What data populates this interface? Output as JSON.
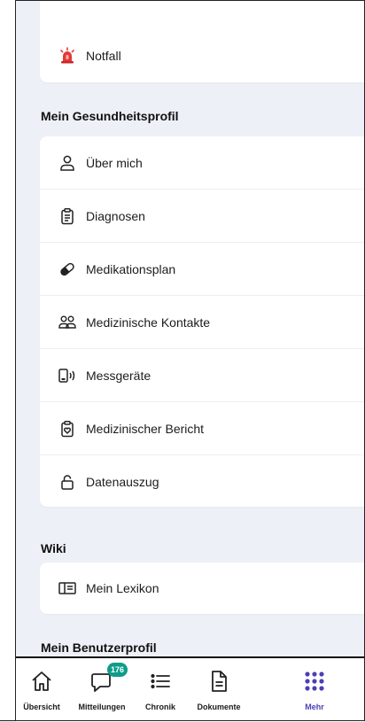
{
  "top_card": {
    "label": "Notfall"
  },
  "health_section": {
    "title": "Mein Gesundheitsprofil",
    "items": [
      {
        "label": "Über mich",
        "icon": "person-icon"
      },
      {
        "label": "Diagnosen",
        "icon": "clipboard-icon"
      },
      {
        "label": "Medikationsplan",
        "icon": "pill-icon"
      },
      {
        "label": "Medizinische Kontakte",
        "icon": "contacts-icon"
      },
      {
        "label": "Messgeräte",
        "icon": "device-icon"
      },
      {
        "label": "Medizinischer Bericht",
        "icon": "report-icon"
      },
      {
        "label": "Datenauszug",
        "icon": "lock-icon"
      }
    ]
  },
  "wiki_section": {
    "title": "Wiki",
    "items": [
      {
        "label": "Mein Lexikon",
        "icon": "book-icon"
      }
    ]
  },
  "profile_section": {
    "title": "Mein Benutzerprofil"
  },
  "tabbar": {
    "tabs": [
      {
        "label": "Übersicht",
        "icon": "home-icon"
      },
      {
        "label": "Mitteilungen",
        "icon": "chat-icon",
        "badge": "176"
      },
      {
        "label": "Chronik",
        "icon": "list-icon"
      },
      {
        "label": "Dokumente",
        "icon": "document-icon"
      },
      {
        "label": "Mehr",
        "icon": "grid-dots-icon",
        "active": true
      }
    ],
    "accent": "#4b3fb5",
    "badge_color": "#0e9c8a"
  }
}
